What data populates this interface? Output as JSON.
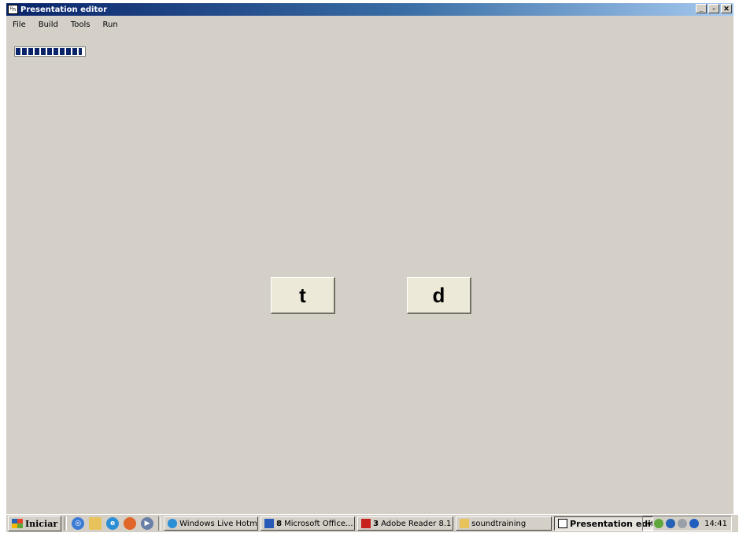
{
  "window": {
    "title": "Presentation editor",
    "app_icon_glyph": "ᴾn",
    "controls": {
      "minimize": "_",
      "maximize": "▫",
      "close": "✕"
    }
  },
  "menu": {
    "items": [
      "File",
      "Build",
      "Tools",
      "Run"
    ]
  },
  "progress": {
    "fraction": 0.97
  },
  "choices": [
    {
      "label": "t"
    },
    {
      "label": "d"
    }
  ],
  "taskbar": {
    "start_label": "Iniciar",
    "quick_launch": [
      "desktop-icon",
      "folder-icon",
      "ie-icon",
      "firefox-icon",
      "media-icon"
    ],
    "tasks": [
      {
        "label": "Windows Live Hotm...",
        "icon": "ie-icon",
        "count": "",
        "dropdown": false,
        "active": false
      },
      {
        "label": "Microsoft Office...",
        "icon": "word-icon",
        "count": "8",
        "dropdown": true,
        "active": false
      },
      {
        "label": "Adobe Reader 8.1",
        "icon": "acrobat-icon",
        "count": "3",
        "dropdown": true,
        "active": false
      },
      {
        "label": "soundtraining",
        "icon": "folder-icon",
        "count": "",
        "dropdown": false,
        "active": false
      },
      {
        "label": "Presentation edit...",
        "icon": "app-icon",
        "count": "",
        "dropdown": false,
        "active": true
      }
    ],
    "tray": {
      "expand": "«",
      "time": "14:41",
      "icons": [
        "network-icon",
        "security-icon",
        "volume-icon",
        "update-icon"
      ]
    }
  },
  "colors": {
    "desktop": "#d4d0c8",
    "titlebar_start": "#0a246a",
    "titlebar_end": "#a6caf0",
    "progress": "#0a246a"
  }
}
